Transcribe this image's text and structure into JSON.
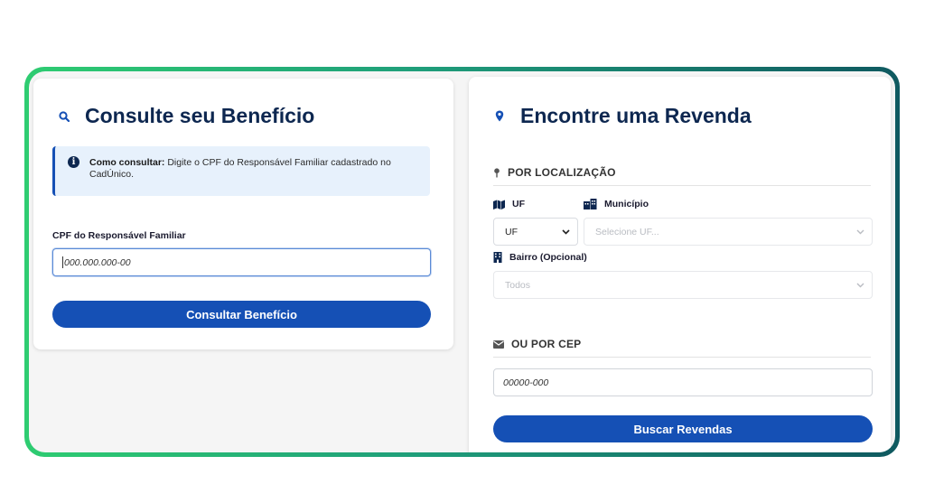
{
  "consulta": {
    "title": "Consulte seu Benefício",
    "info_bold": "Como consultar:",
    "info_text": " Digite o CPF do Responsável Familiar cadastrado no CadÚnico.",
    "cpf_label": "CPF do Responsável Familiar",
    "cpf_placeholder": "000.000.000-00",
    "submit_label": "Consultar Benefício"
  },
  "revenda": {
    "title": "Encontre uma Revenda",
    "by_location_heading": "POR LOCALIZAÇÃO",
    "uf_label": "UF",
    "uf_value": "UF",
    "municipio_label": "Município",
    "municipio_value": "Selecione UF...",
    "bairro_label": "Bairro (Opcional)",
    "bairro_value": "Todos",
    "by_cep_heading": "OU POR CEP",
    "cep_placeholder": "00000-000",
    "submit_label": "Buscar Revendas"
  },
  "colors": {
    "primary": "#1550b5",
    "heading": "#0d2750",
    "border_gradient_start": "#2ecc71",
    "border_gradient_end": "#0f5960",
    "info_bg": "#e7f1fc"
  },
  "icons": [
    "search-icon",
    "map-pin-icon",
    "info-icon",
    "map-icon",
    "city-icon",
    "building-icon",
    "envelope-icon",
    "chevron-down-icon"
  ]
}
